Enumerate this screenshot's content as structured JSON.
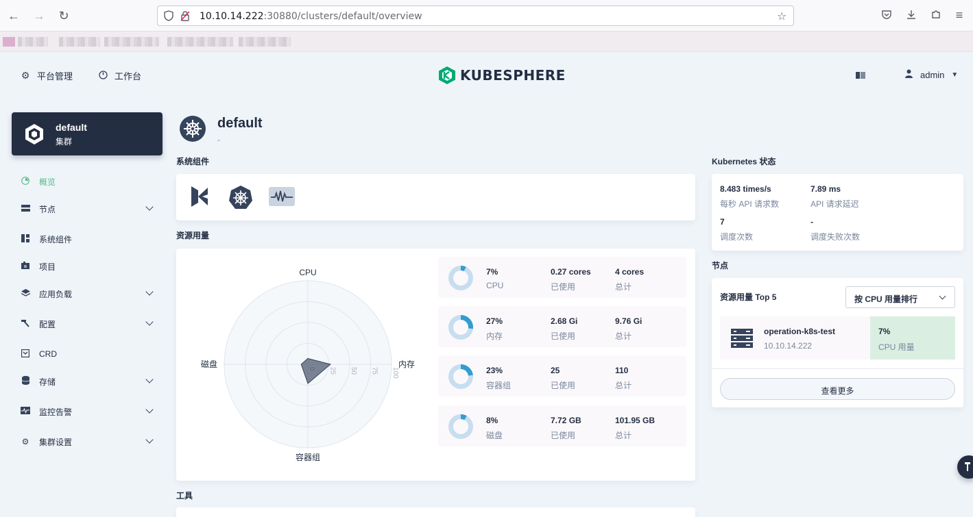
{
  "browser": {
    "url_host": "10.10.14.222",
    "url_path": ":30880/clusters/default/overview"
  },
  "header": {
    "platform_label": "平台管理",
    "workbench_label": "工作台",
    "logo_text": "KUBESPHERE",
    "user_name": "admin"
  },
  "sidebar": {
    "cluster_name": "default",
    "cluster_type": "集群",
    "items": [
      {
        "label": "概览",
        "icon": "overview-icon",
        "expandable": false,
        "active": true
      },
      {
        "label": "节点",
        "icon": "server-icon",
        "expandable": true
      },
      {
        "label": "系统组件",
        "icon": "components-icon",
        "expandable": false
      },
      {
        "label": "项目",
        "icon": "project-icon",
        "expandable": false
      },
      {
        "label": "应用负载",
        "icon": "layers-icon",
        "expandable": true
      },
      {
        "label": "配置",
        "icon": "hammer-icon",
        "expandable": true
      },
      {
        "label": "CRD",
        "icon": "crd-icon",
        "expandable": false
      },
      {
        "label": "存储",
        "icon": "database-icon",
        "expandable": true
      },
      {
        "label": "监控告警",
        "icon": "monitor-icon",
        "expandable": true
      },
      {
        "label": "集群设置",
        "icon": "gear-icon",
        "expandable": true
      }
    ]
  },
  "main": {
    "title": "default",
    "subtitle": "-",
    "system_components_label": "系统组件",
    "resource_usage_label": "资源用量",
    "tools_label": "工具"
  },
  "radar": {
    "axes": [
      "CPU",
      "内存",
      "容器组",
      "磁盘"
    ],
    "ticks": [
      "0",
      "25",
      "50",
      "75",
      "100"
    ],
    "values": [
      7,
      27,
      23,
      8
    ]
  },
  "usage": [
    {
      "percent": "7%",
      "percent_value": 7,
      "name": "CPU",
      "used": "0.27 cores",
      "used_label": "已使用",
      "total": "4 cores",
      "total_label": "总计"
    },
    {
      "percent": "27%",
      "percent_value": 27,
      "name": "内存",
      "used": "2.68 Gi",
      "used_label": "已使用",
      "total": "9.76 Gi",
      "total_label": "总计"
    },
    {
      "percent": "23%",
      "percent_value": 23,
      "name": "容器组",
      "used": "25",
      "used_label": "已使用",
      "total": "110",
      "total_label": "总计"
    },
    {
      "percent": "8%",
      "percent_value": 8,
      "name": "磁盘",
      "used": "7.72 GB",
      "used_label": "已使用",
      "total": "101.95 GB",
      "total_label": "总计"
    }
  ],
  "k8s_status": {
    "title": "Kubernetes 状态",
    "api_rate": "8.483 times/s",
    "api_rate_label": "每秒 API 请求数",
    "api_latency": "7.89 ms",
    "api_latency_label": "API 请求延迟",
    "schedule_count": "7",
    "schedule_count_label": "调度次数",
    "schedule_fail": "-",
    "schedule_fail_label": "调度失败次数"
  },
  "nodes": {
    "title": "节点",
    "top5_label": "资源用量 Top 5",
    "sort_select": "按 CPU 用量排行",
    "node_name": "operation-k8s-test",
    "node_ip": "10.10.14.222",
    "cpu_percent": "7%",
    "cpu_label": "CPU 用量",
    "more_button": "查看更多"
  },
  "colors": {
    "accent_green": "#55bc8a",
    "dark": "#242e42",
    "donut_fill": "#329dce",
    "donut_track": "#c7deef"
  }
}
